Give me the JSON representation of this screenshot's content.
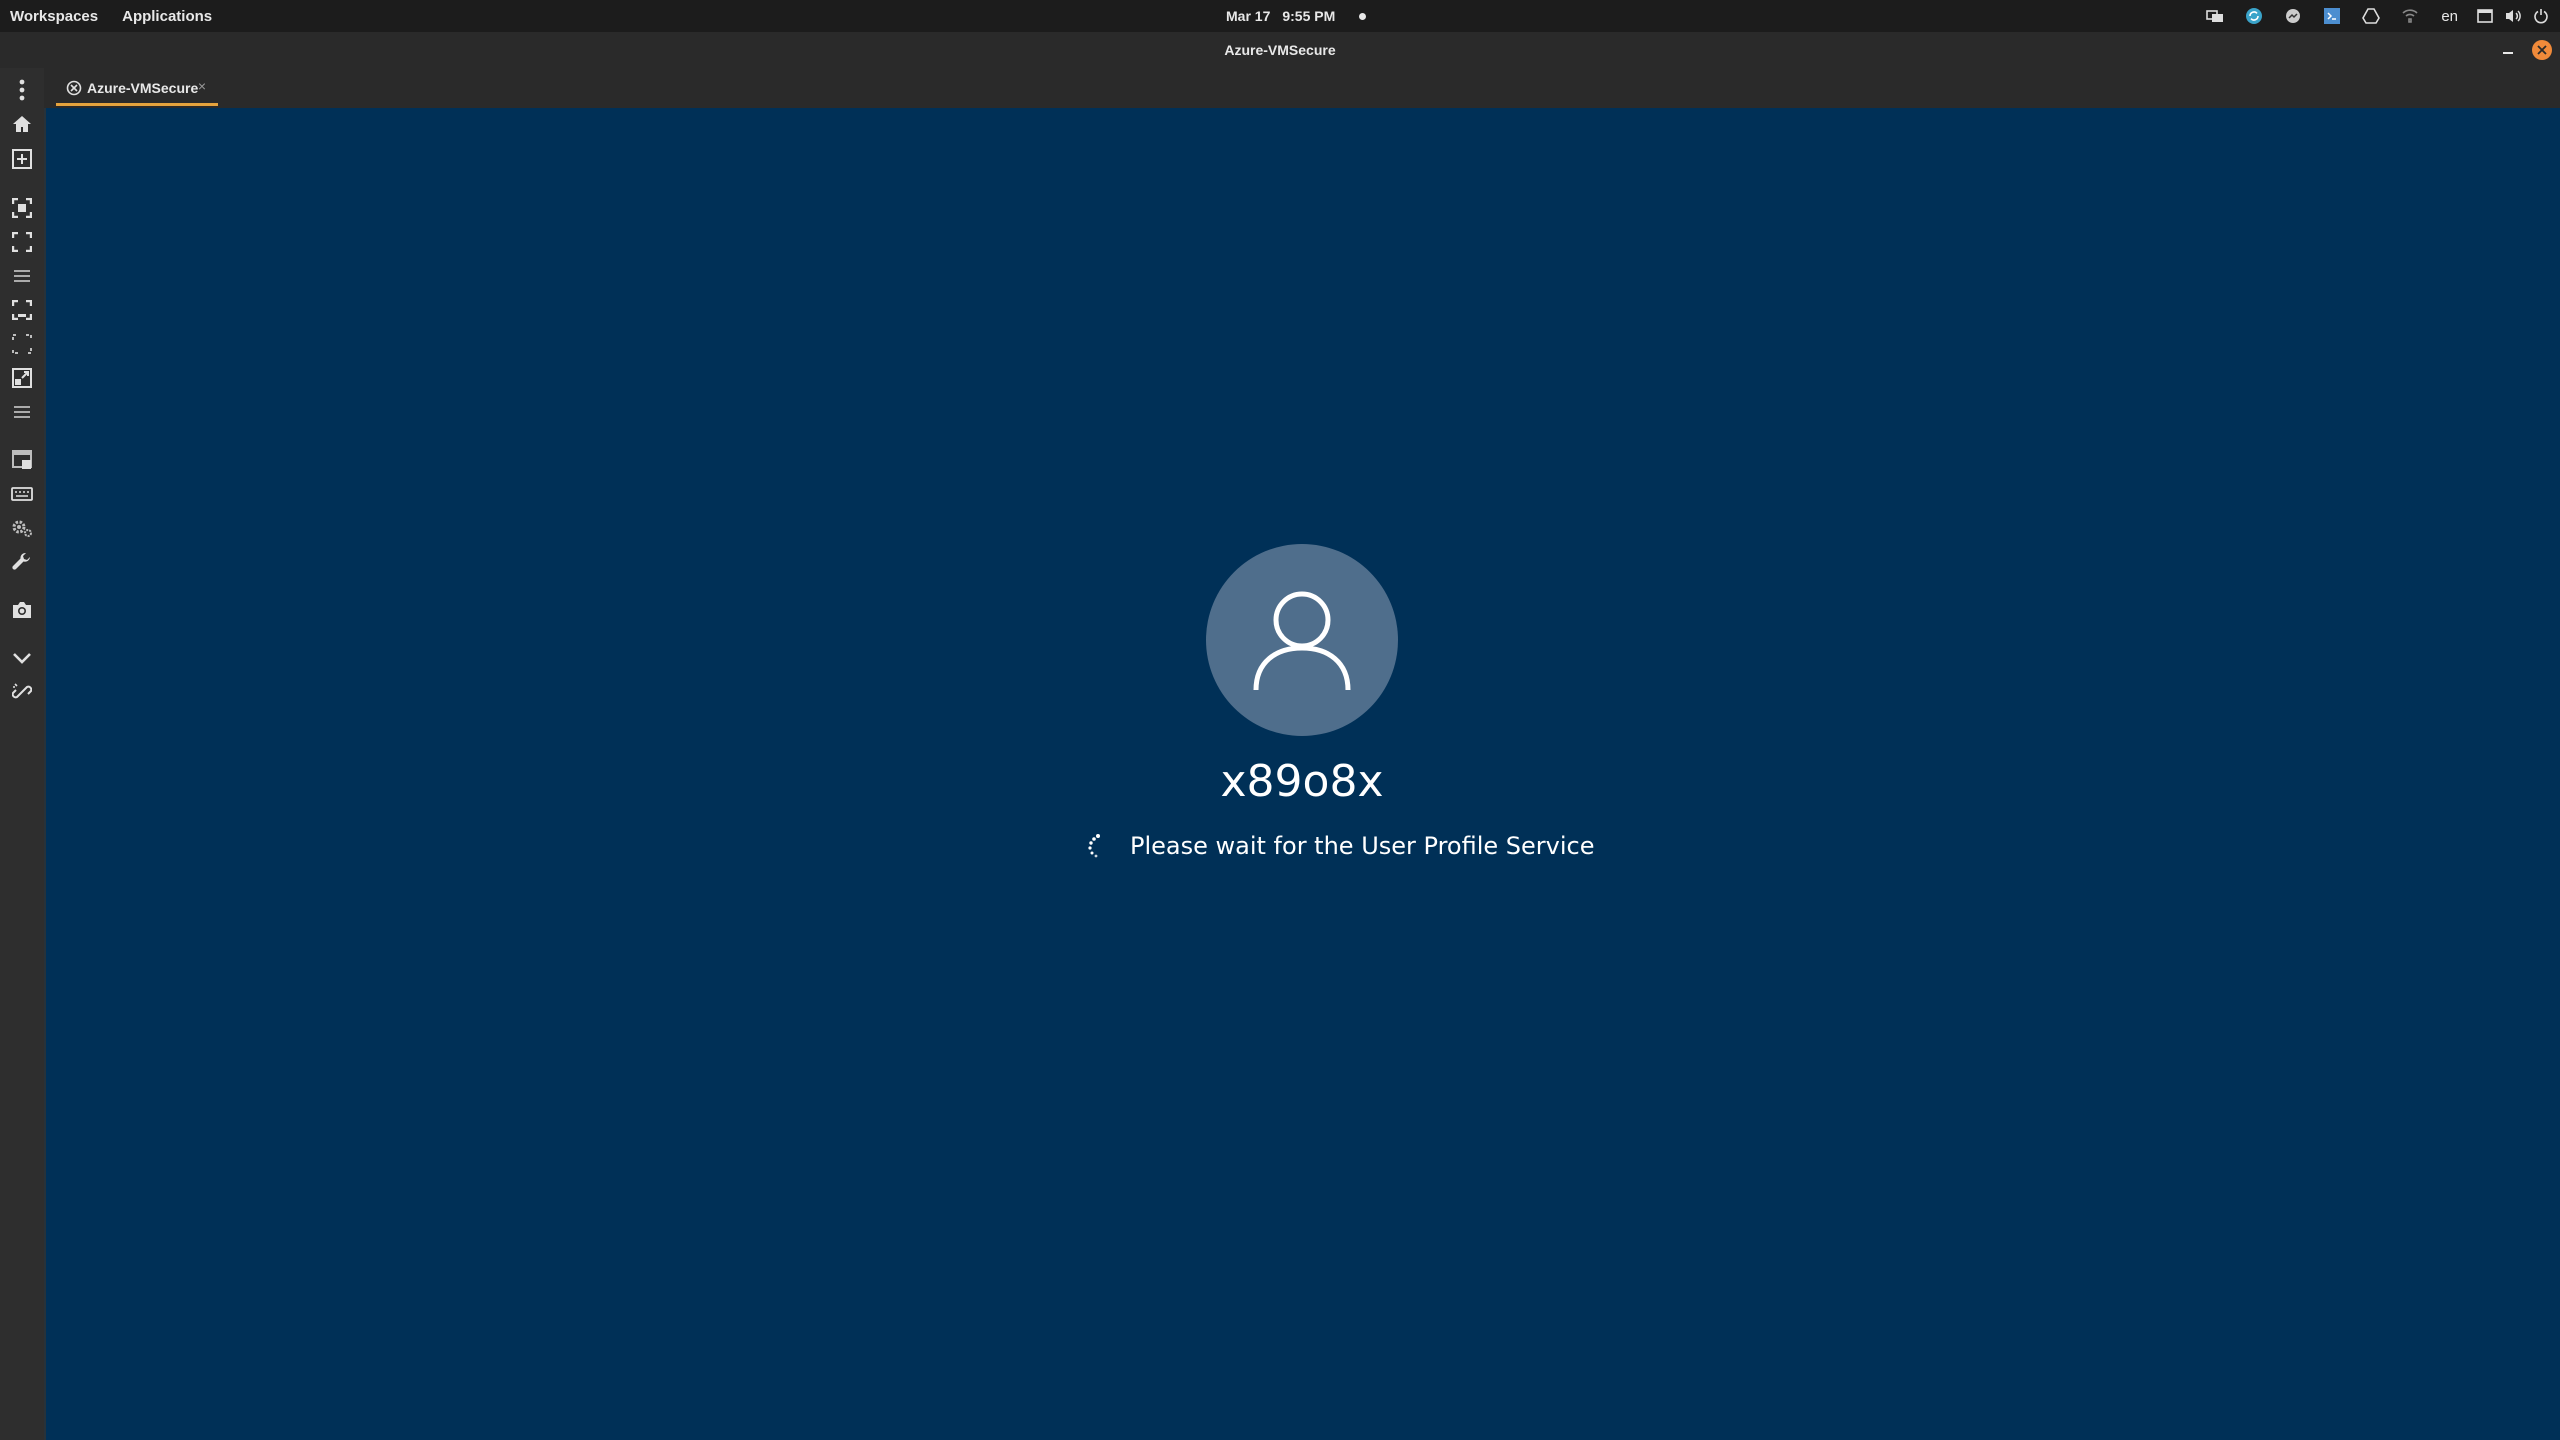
{
  "topbar": {
    "workspaces": "Workspaces",
    "applications": "Applications",
    "date": "Mar 17",
    "time": "9:55 PM",
    "tray_icons": [
      "connections-icon",
      "sync-icon",
      "messenger-icon",
      "vscode-icon",
      "drive-icon",
      "network-icon"
    ],
    "language": "en",
    "system_icons": [
      "window-icon",
      "volume-icon",
      "power-icon"
    ]
  },
  "window": {
    "title": "Azure-VMSecure"
  },
  "sidebar": {
    "buttons": [
      "more-options-icon",
      "home-icon",
      "new-connection-icon",
      "fit-window-icon",
      "fullscreen-icon",
      "menu-icon",
      "resize-icon",
      "scale-icon",
      "smart-sizing-icon",
      "menu-secondary-icon",
      "window-mode-icon",
      "keyboard-icon",
      "settings-icon",
      "tools-icon",
      "screenshot-icon",
      "collapse-icon",
      "disconnect-icon"
    ]
  },
  "tabs": [
    {
      "label": "Azure-VMSecure",
      "close": "×",
      "active": true
    }
  ],
  "remote": {
    "background_color": "#003057",
    "avatar_color": "#4f6e8c",
    "username": "x89o8x",
    "status": "Please wait for the User Profile Service"
  },
  "colors": {
    "accent": "#e5a33d",
    "close_button": "#f08a3a"
  }
}
